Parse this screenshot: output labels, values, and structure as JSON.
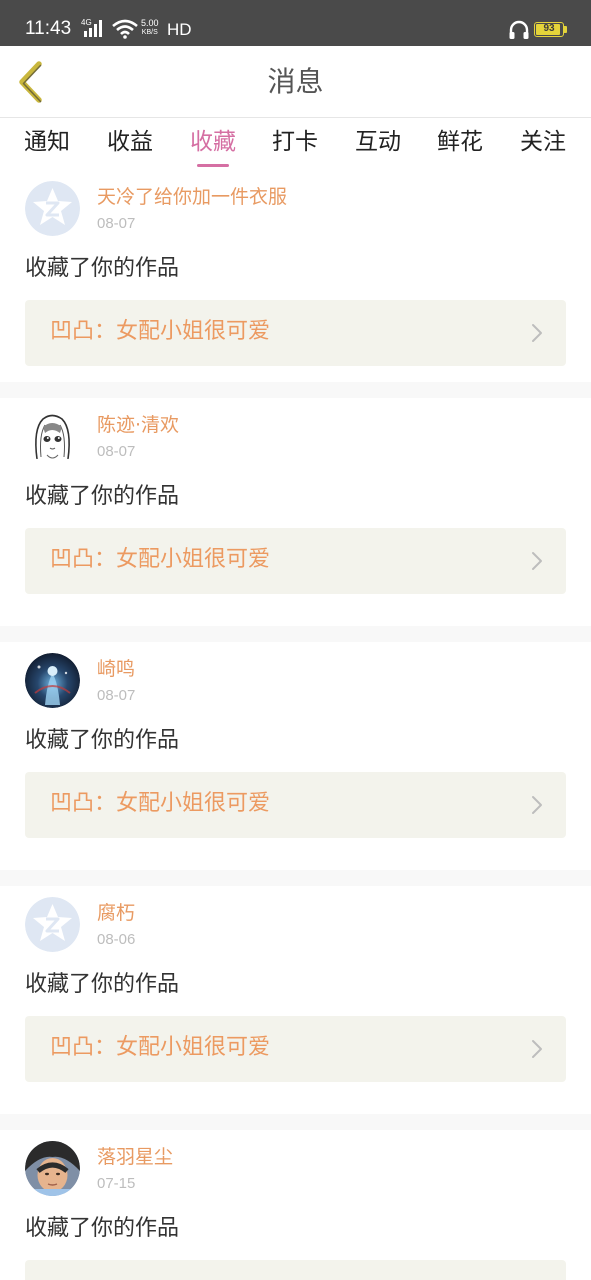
{
  "status_bar": {
    "time": "11:43",
    "network": "4G",
    "speed_value": "5.00",
    "speed_unit": "KB/S",
    "hd": "HD",
    "battery": "93",
    "battery_level": 0.93,
    "battery_color": "#e4d43a"
  },
  "header": {
    "title": "消息",
    "back_icon": "chevron-left-icon",
    "back_color": "#c9b73e"
  },
  "tabs": {
    "items": [
      "通知",
      "收益",
      "收藏",
      "打卡",
      "互动",
      "鲜花",
      "关注"
    ],
    "active_index": 2,
    "active_color": "#d56fa3"
  },
  "feed": {
    "items": [
      {
        "avatar": "default-star-avatar",
        "username": "天冷了给你加一件衣服",
        "date": "08-07",
        "action": "收藏了你的作品",
        "work_title": "凹凸：女配小姐很可爱"
      },
      {
        "avatar": "anime-girl-sketch-avatar",
        "username": "陈迹·清欢",
        "date": "08-07",
        "action": "收藏了你的作品",
        "work_title": "凹凸：女配小姐很可爱"
      },
      {
        "avatar": "blue-glow-figure-avatar",
        "username": "崎鸣",
        "date": "08-07",
        "action": "收藏了你的作品",
        "work_title": "凹凸：女配小姐很可爱"
      },
      {
        "avatar": "default-star-avatar",
        "username": "腐朽",
        "date": "08-06",
        "action": "收藏了你的作品",
        "work_title": "凹凸：女配小姐很可爱"
      },
      {
        "avatar": "photo-face-avatar",
        "username": "落羽星尘",
        "date": "07-15",
        "action": "收藏了你的作品",
        "work_title": ""
      }
    ]
  },
  "colors": {
    "username": "#e89a62",
    "work_title": "#ec9a61",
    "work_box_bg": "#f3f3ec",
    "separator": "#f8f8f8"
  }
}
